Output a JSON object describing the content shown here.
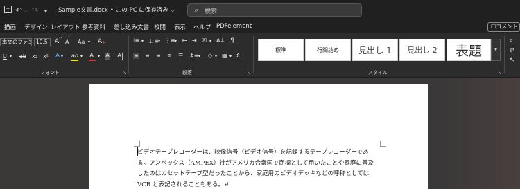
{
  "titlebar": {
    "save_icon": "save-icon",
    "undo_icon": "undo-icon",
    "redo_icon": "redo-icon",
    "customize_icon": "customize-quick-access-icon",
    "document_name": "Sample文書.docx",
    "separator": "•",
    "save_status": "この PC に保存済み",
    "save_status_chevron": "⌵",
    "search_placeholder": "検索"
  },
  "menu": {
    "tabs": [
      "描画",
      "デザイン",
      "レイアウト",
      "参考資料",
      "差し込み文書",
      "校閲",
      "表示",
      "ヘルプ",
      "PDFelement"
    ],
    "comment_label": "コメント"
  },
  "ribbon": {
    "font": {
      "name": "本文のフォント",
      "size": "10.5",
      "grow_label": "A",
      "shrink_label": "A",
      "change_case_label": "Aa",
      "clear_format_label": "A",
      "underline_label": "U",
      "strike_label": "ab",
      "subscript_label": "x₂",
      "superscript_label": "x²",
      "effects_label": "A",
      "highlight_label": "ab",
      "font_color_label": "A",
      "char_shade_label": "A",
      "char_border_label": "A",
      "group_label": "フォント"
    },
    "paragraph": {
      "group_label": "段落",
      "sort_label": "A↓",
      "marks_label": "¶"
    },
    "styles": {
      "items": [
        "標準",
        "行間詰め",
        "見出し 1",
        "見出し 2",
        "表題"
      ],
      "group_label": "スタイル",
      "more_label": "▾"
    },
    "editing": {
      "find_icon": "find-icon",
      "replace_icon": "replace-icon",
      "select_icon": "select-icon"
    }
  },
  "document": {
    "lines": [
      "ビデオテープレコーダーは、映像信号（ビデオ信号）を記録するテープレコーダーであ",
      "る。アンペックス（AMPEX）社がアメリカ合衆国で商標として用いたことや家庭に普及",
      "したのはカセットテープ型だったことから、家庭用のビデオデッキなどの呼称としては",
      "VCR と表記されることもある。↵"
    ]
  },
  "colors": {
    "title_bar": "#202020",
    "ribbon": "#2c2c2c",
    "canvas": "#3b3838",
    "page": "#ffffff",
    "highlight_yellow": "#f2e600",
    "font_red": "#e03030"
  }
}
